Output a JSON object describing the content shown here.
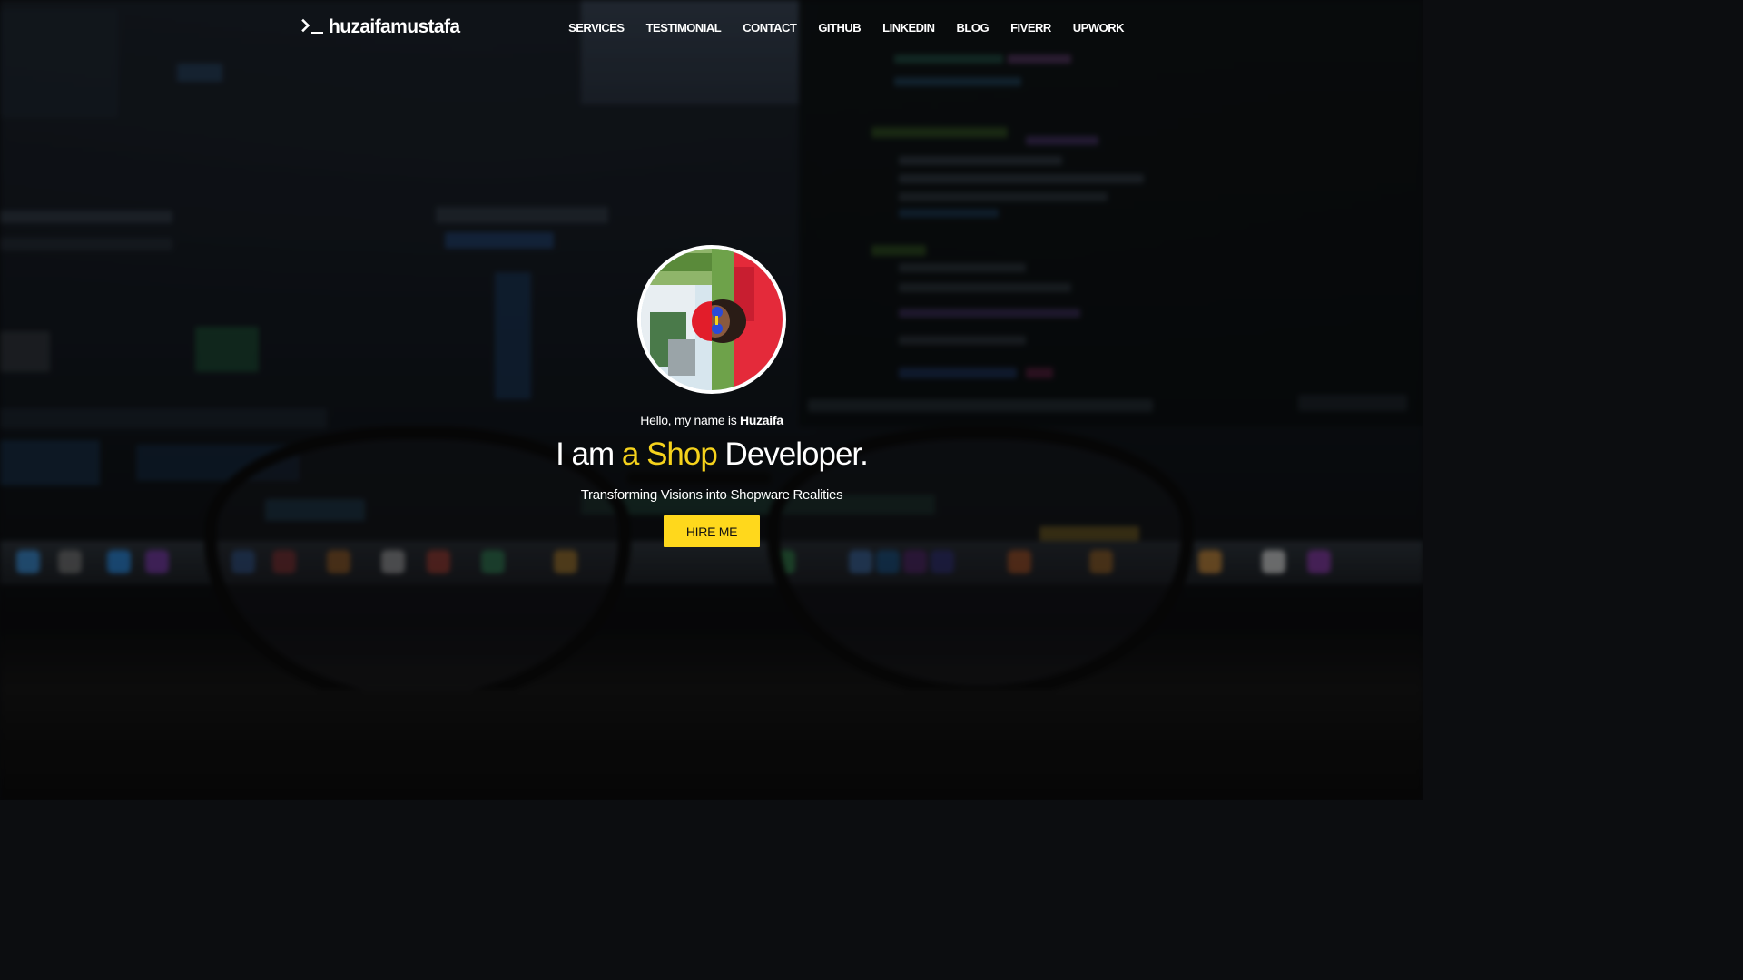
{
  "brand": {
    "icon": "terminal-prompt-icon",
    "name": "huzaifamustafa"
  },
  "nav": {
    "items": [
      {
        "label": "SERVICES"
      },
      {
        "label": "TESTIMONIAL"
      },
      {
        "label": "CONTACT"
      },
      {
        "label": "GITHUB"
      },
      {
        "label": "LINKEDIN"
      },
      {
        "label": "BLOG"
      },
      {
        "label": "FIVERR"
      },
      {
        "label": "UPWORK"
      }
    ]
  },
  "hero": {
    "greeting_prefix": "Hello, my name is ",
    "greeting_name": "Huzaifa",
    "headline_prefix": "I am ",
    "headline_accent": "a Shop",
    "headline_suffix": " Developer.",
    "tagline": "Transforming Visions into Shopware Realities",
    "cta_label": "HIRE ME"
  },
  "colors": {
    "accent": "#f5d21c",
    "button": "#ffd81c",
    "text": "#ffffff",
    "background": "#0c0d10"
  }
}
